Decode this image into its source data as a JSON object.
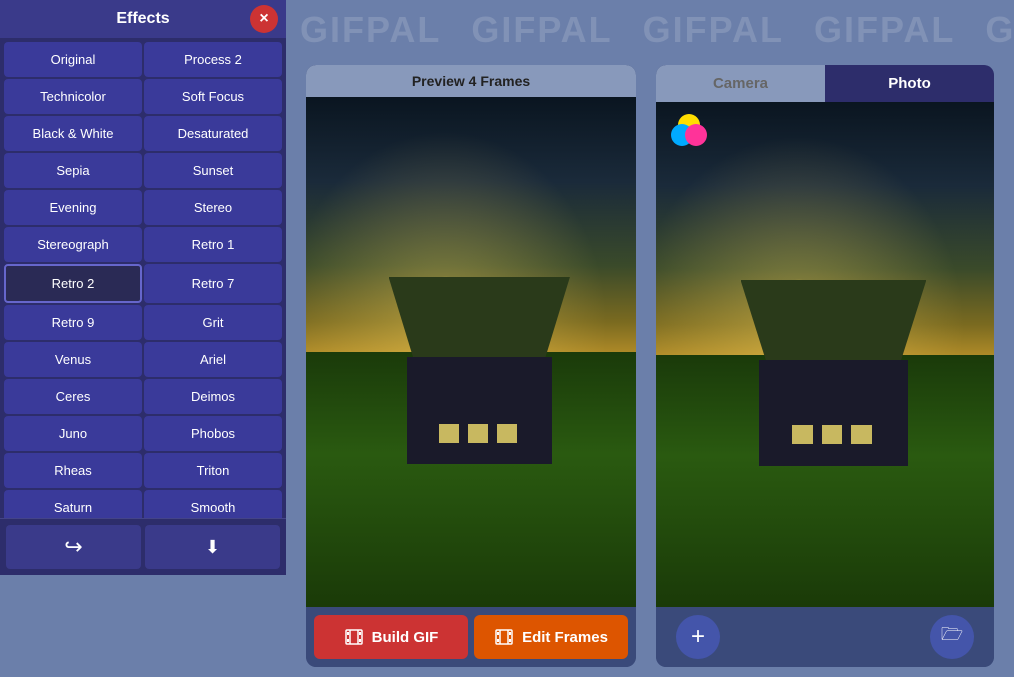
{
  "watermark": {
    "texts": [
      "GIFPAL",
      "GIFPAL",
      "GIFPAL",
      "GIFPAL",
      "GIFPA"
    ]
  },
  "effects": {
    "title": "Effects",
    "close_label": "×",
    "buttons": [
      {
        "id": "original",
        "label": "Original",
        "active": false
      },
      {
        "id": "process2",
        "label": "Process 2",
        "active": false
      },
      {
        "id": "technicolor",
        "label": "Technicolor",
        "active": false
      },
      {
        "id": "soft-focus",
        "label": "Soft Focus",
        "active": false
      },
      {
        "id": "black-white",
        "label": "Black & White",
        "active": false
      },
      {
        "id": "desaturated",
        "label": "Desaturated",
        "active": false
      },
      {
        "id": "sepia",
        "label": "Sepia",
        "active": false
      },
      {
        "id": "sunset",
        "label": "Sunset",
        "active": false
      },
      {
        "id": "evening",
        "label": "Evening",
        "active": false
      },
      {
        "id": "stereo",
        "label": "Stereo",
        "active": false
      },
      {
        "id": "stereograph",
        "label": "Stereograph",
        "active": false
      },
      {
        "id": "retro1",
        "label": "Retro 1",
        "active": false
      },
      {
        "id": "retro2",
        "label": "Retro 2",
        "active": true
      },
      {
        "id": "retro7",
        "label": "Retro 7",
        "active": false
      },
      {
        "id": "retro9",
        "label": "Retro 9",
        "active": false
      },
      {
        "id": "grit",
        "label": "Grit",
        "active": false
      },
      {
        "id": "venus",
        "label": "Venus",
        "active": false
      },
      {
        "id": "ariel",
        "label": "Ariel",
        "active": false
      },
      {
        "id": "ceres",
        "label": "Ceres",
        "active": false
      },
      {
        "id": "deimos",
        "label": "Deimos",
        "active": false
      },
      {
        "id": "juno",
        "label": "Juno",
        "active": false
      },
      {
        "id": "phobos",
        "label": "Phobos",
        "active": false
      },
      {
        "id": "rheas",
        "label": "Rheas",
        "active": false
      },
      {
        "id": "triton",
        "label": "Triton",
        "active": false
      },
      {
        "id": "saturn",
        "label": "Saturn",
        "active": false
      },
      {
        "id": "smooth",
        "label": "Smooth",
        "active": false
      }
    ],
    "footer_btns": [
      {
        "id": "share",
        "icon": "↪",
        "label": "share"
      },
      {
        "id": "save",
        "icon": "⬇",
        "label": "save"
      }
    ]
  },
  "preview": {
    "header": "Preview 4 Frames",
    "build_gif": "Build GIF",
    "edit_frames": "Edit Frames"
  },
  "photo": {
    "tab_camera": "Camera",
    "tab_photo": "Photo",
    "add_label": "+",
    "folder_label": "🗁"
  }
}
